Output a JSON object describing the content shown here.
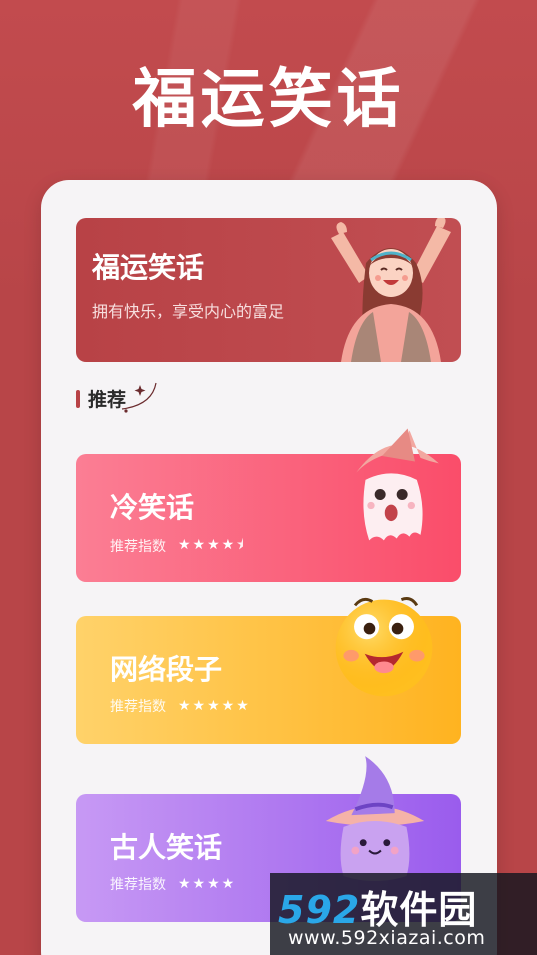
{
  "header": {
    "title": "福运笑话"
  },
  "banner": {
    "title": "福运笑话",
    "subtitle": "拥有快乐，享受内心的富足",
    "color": "#b84246"
  },
  "section": {
    "label": "推荐"
  },
  "cards": [
    {
      "title": "冷笑话",
      "rating_label": "推荐指数",
      "stars": "★★★★",
      "rating": 4.5,
      "color": "#fa4d6a"
    },
    {
      "title": "网络段子",
      "rating_label": "推荐指数",
      "stars": "★★★★★",
      "rating": 5,
      "color": "#ffb320"
    },
    {
      "title": "古人笑话",
      "rating_label": "推荐指数",
      "stars": "★★★★",
      "rating": 4,
      "color": "#9a5ced"
    }
  ],
  "watermark": {
    "brand_num": "592",
    "brand_cn": "软件园",
    "url": "www.592xiazai.com"
  },
  "colors": {
    "background": "#b84548",
    "panel": "#f6f4f6"
  }
}
